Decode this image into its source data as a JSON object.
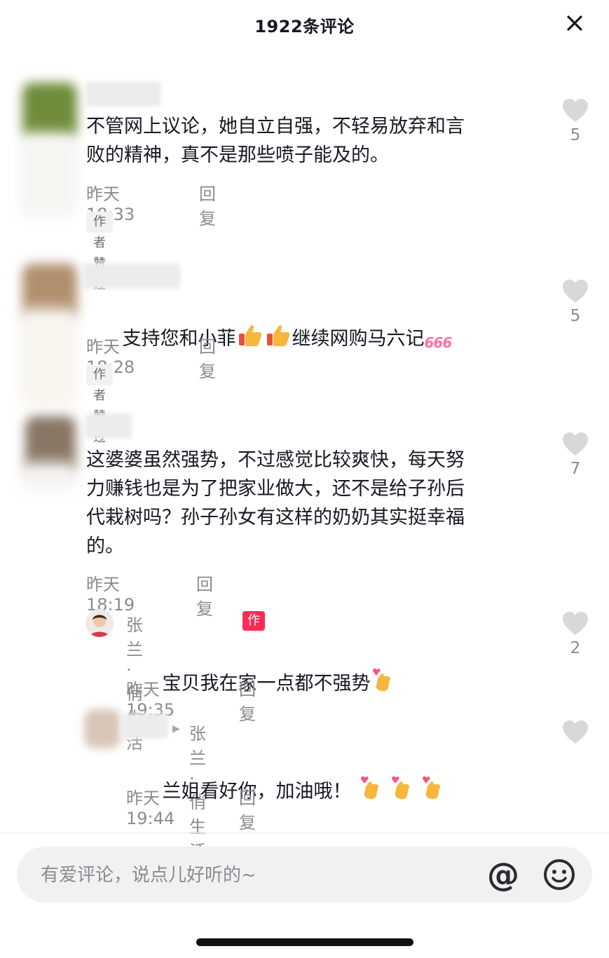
{
  "header": {
    "title": "1922条评论"
  },
  "comments": [
    {
      "text": "不管网上议论，她自立自强，不轻易放弃和言\n败的精神，真不是那些喷子能及的。",
      "time": "昨天 18:33",
      "reply_label": "回复",
      "tag": "作者赞过",
      "likes": "5"
    },
    {
      "text_before": "支持您和小菲",
      "text_after": "继续网购马六记",
      "sticker_text": "666",
      "time": "昨天 18:28",
      "reply_label": "回复",
      "tag": "作者赞过",
      "likes": "5"
    },
    {
      "text": "这婆婆虽然强势，不过感觉比较爽快，每天努\n力赚钱也是为了把家业做大，还不是给子孙后\n代栽树吗？孙子孙女有这样的奶奶其实挺幸福\n的。",
      "time": "昨天 18:19",
      "reply_label": "回复",
      "likes": "7"
    }
  ],
  "replies": [
    {
      "author": "张兰 · 俏生活",
      "badge": "作者",
      "text": "宝贝我在家一点都不强势",
      "time": "昨天 19:35",
      "reply_label": "回复",
      "likes": "2"
    },
    {
      "reply_to": "张兰 · 俏生活",
      "text": "兰姐看好你，加油哦！",
      "time": "昨天 19:44",
      "reply_label": "回复"
    }
  ],
  "composer": {
    "placeholder": "有爱评论，说点儿好听的~",
    "at_label": "@"
  },
  "colors": {
    "accent": "#fe2c55",
    "muted_text": "#8a8b91",
    "primary_text": "#161823",
    "heart_gray": "#d8d8da"
  }
}
